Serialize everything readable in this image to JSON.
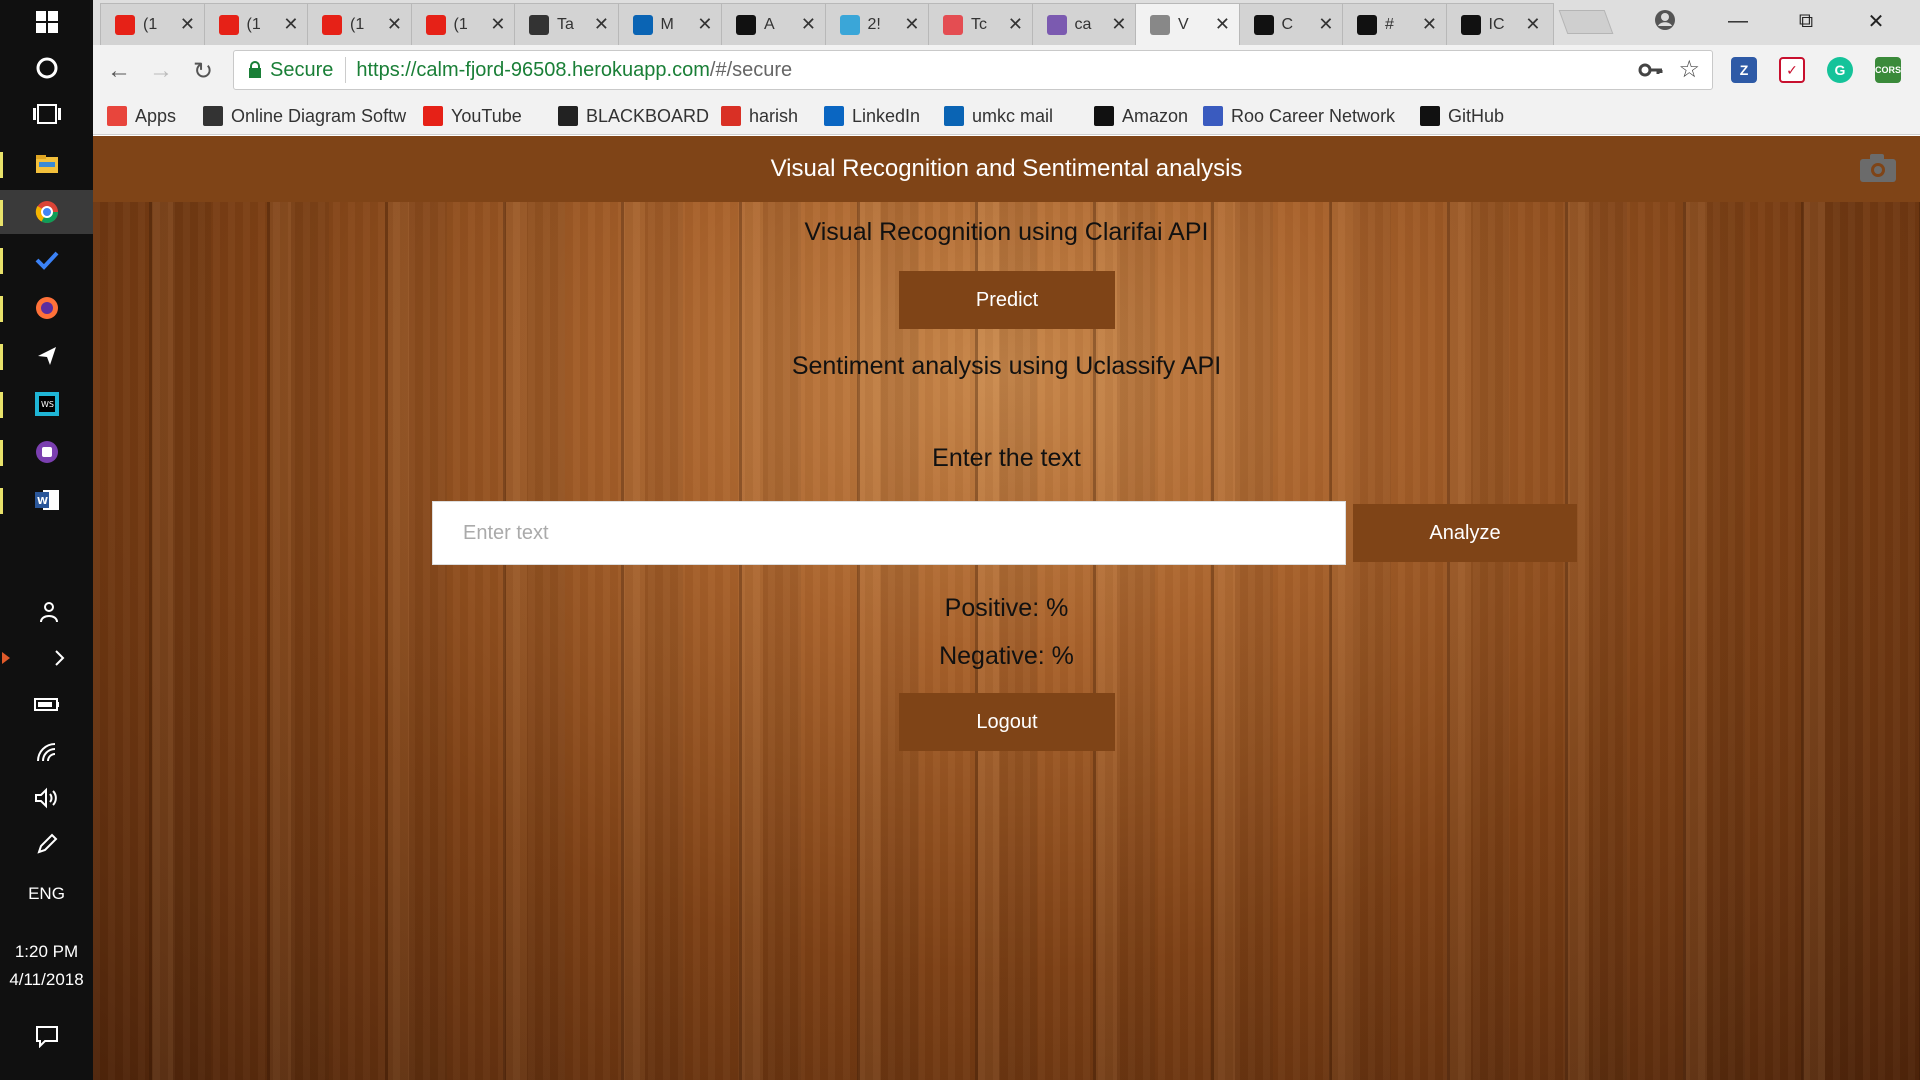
{
  "taskbar": {
    "language": "ENG",
    "time": "1:20 PM",
    "date": "4/11/2018",
    "icons": [
      "windows-start-icon",
      "cortana-icon",
      "task-view-icon",
      "file-explorer-icon",
      "chrome-icon",
      "todo-icon",
      "firefox-icon",
      "send-icon",
      "webstorm-icon",
      "app-icon",
      "word-icon"
    ]
  },
  "tabs": [
    {
      "title": "(1",
      "icon": "youtube-icon",
      "color": "#e62117"
    },
    {
      "title": "(1",
      "icon": "youtube-icon",
      "color": "#e62117"
    },
    {
      "title": "(1",
      "icon": "youtube-icon",
      "color": "#e62117"
    },
    {
      "title": "(1",
      "icon": "youtube-icon",
      "color": "#e62117"
    },
    {
      "title": "Ta",
      "icon": "layers-icon",
      "color": "#333333"
    },
    {
      "title": "M",
      "icon": "outlook-icon",
      "color": "#0a64b4"
    },
    {
      "title": "A",
      "icon": "amazon-icon",
      "color": "#111111"
    },
    {
      "title": "2!",
      "icon": "quest-icon",
      "color": "#3aa6d8"
    },
    {
      "title": "Tc",
      "icon": "udemy-icon",
      "color": "#e44d52"
    },
    {
      "title": "ca",
      "icon": "heroku-icon",
      "color": "#7b5ab0"
    },
    {
      "title": "V",
      "icon": "page-icon",
      "color": "#888888",
      "active": true
    },
    {
      "title": "C",
      "icon": "github-icon",
      "color": "#111111"
    },
    {
      "title": "#",
      "icon": "github-icon",
      "color": "#111111"
    },
    {
      "title": "IC",
      "icon": "github-icon",
      "color": "#111111"
    }
  ],
  "address_bar": {
    "secure_label": "Secure",
    "url_host": "https://calm-fjord-96508.herokuapp.com",
    "url_path": "/#/secure"
  },
  "bookmarks": [
    {
      "label": "Apps",
      "icon": "apps-grid-icon",
      "color": "#e8453c"
    },
    {
      "label": "Online Diagram Softw",
      "icon": "bulb-icon",
      "color": "#333333"
    },
    {
      "label": "YouTube",
      "icon": "youtube-icon",
      "color": "#e62117"
    },
    {
      "label": "BLACKBOARD",
      "icon": "blackboard-icon",
      "color": "#222222"
    },
    {
      "label": "harish",
      "icon": "gmail-icon",
      "color": "#d93025"
    },
    {
      "label": "LinkedIn",
      "icon": "linkedin-icon",
      "color": "#0a66c2"
    },
    {
      "label": "umkc  mail",
      "icon": "outlook-icon",
      "color": "#0a64b4"
    },
    {
      "label": "Amazon",
      "icon": "amazon-icon",
      "color": "#111111"
    },
    {
      "label": "Roo Career Network",
      "icon": "roo-icon",
      "color": "#3a5bbf"
    },
    {
      "label": "GitHub",
      "icon": "github-icon",
      "color": "#111111"
    }
  ],
  "app": {
    "header_title": "Visual Recognition and Sentimental analysis",
    "visual_heading": "Visual Recognition using Clarifai API",
    "predict_label": "Predict",
    "sentiment_heading": "Sentiment analysis using Uclassify API",
    "enter_text_label": "Enter the text",
    "input_placeholder": "Enter text",
    "input_value": "",
    "analyze_label": "Analyze",
    "positive_label": "Positive: %",
    "negative_label": "Negative: %",
    "logout_label": "Logout",
    "accent_color": "#7f4417"
  }
}
